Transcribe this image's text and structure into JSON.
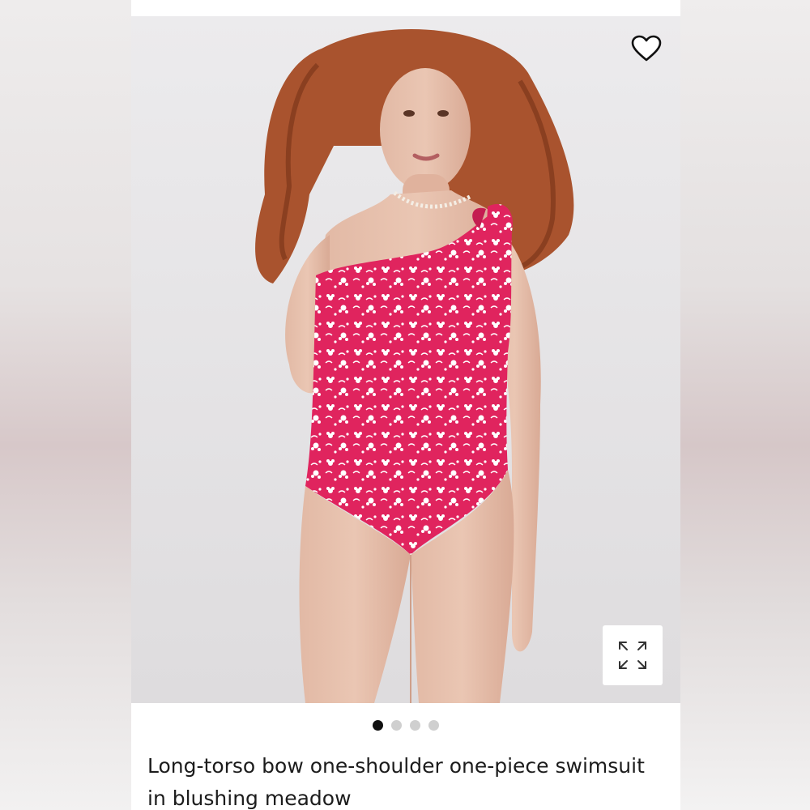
{
  "product": {
    "title": "Long-torso bow one-shoulder one-piece swimsuit in blushing meadow",
    "image_alt": "Model wearing pink floral one-shoulder swimsuit with bow"
  },
  "carousel": {
    "total_slides": 4,
    "active_index": 0
  },
  "icons": {
    "favorite": "heart-icon",
    "expand": "expand-icon"
  },
  "colors": {
    "swimsuit_pink": "#e0245e",
    "photo_background": "#e7e6e8",
    "active_dot": "#111111",
    "inactive_dot": "#cfcfcf",
    "text": "#1c1c1c"
  }
}
